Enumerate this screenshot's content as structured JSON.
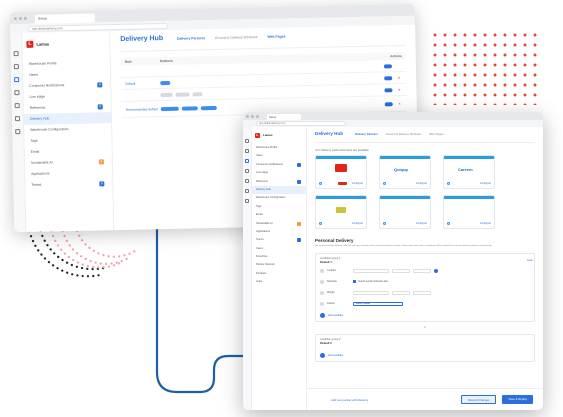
{
  "colors": {
    "accent": "#2a6fdb",
    "brand_red": "#e1251b",
    "dots_red": "#e8452c",
    "dots_pink": "#f0a4ab",
    "connector": "#1e5ea8"
  },
  "window_back": {
    "browser_tab": "Setup",
    "url": "app.dokandelivery.com",
    "logo": "Lamas",
    "nav": [
      {
        "label": "Warehouse Profile",
        "badge": ""
      },
      {
        "label": "Users",
        "badge": ""
      },
      {
        "label": "Consumer Notifications",
        "badge": "8"
      },
      {
        "label": "Line stage",
        "badge": ""
      },
      {
        "label": "Reference",
        "badge": "8"
      },
      {
        "label": "Delivery Hub",
        "badge": ""
      },
      {
        "label": "Warehouse Configuration",
        "badge": ""
      },
      {
        "label": "Tags",
        "badge": ""
      },
      {
        "label": "Email",
        "badge": ""
      },
      {
        "label": "Sustainable AI",
        "badge": "8"
      },
      {
        "label": "Applications",
        "badge": ""
      },
      {
        "label": "Teams",
        "badge": "8"
      }
    ],
    "title": "Delivery Hub",
    "tabs": [
      "Delivery Partners",
      "Ground & Delivery Windows",
      "Web Pages"
    ],
    "table_headers": [
      "Rule",
      "Partners",
      "Actions"
    ],
    "rows": [
      {
        "name": "",
        "partner": ""
      },
      {
        "name": "Default",
        "partner": ""
      },
      {
        "name": "",
        "partner": ""
      },
      {
        "name": "Recommended default",
        "partner": ""
      }
    ]
  },
  "window_front": {
    "browser_tab": "Setup",
    "url": "app.dokandelivery.com",
    "logo": "Lamas",
    "nav": [
      {
        "label": "Warehouse Profile",
        "badge": ""
      },
      {
        "label": "Users",
        "badge": ""
      },
      {
        "label": "Consumer Notifications",
        "badge": "8"
      },
      {
        "label": "Line stage",
        "badge": ""
      },
      {
        "label": "Reference",
        "badge": "8"
      },
      {
        "label": "Delivery Hub",
        "badge": ""
      },
      {
        "label": "Warehouse Configuration",
        "badge": ""
      },
      {
        "label": "Tags",
        "badge": ""
      },
      {
        "label": "Email",
        "badge": ""
      },
      {
        "label": "Sustainable AI",
        "badge": "8"
      },
      {
        "label": "Applications",
        "badge": ""
      },
      {
        "label": "Teams",
        "badge": "8"
      },
      {
        "label": "Users",
        "badge": ""
      },
      {
        "label": "Franchise",
        "badge": ""
      },
      {
        "label": "Partner Network",
        "badge": ""
      },
      {
        "label": "Products",
        "badge": ""
      },
      {
        "label": "Links",
        "badge": ""
      }
    ],
    "title": "Delivery Hub",
    "tabs": [
      "Delivery Partners",
      "Ground & Delivery Windows",
      "Web Pages"
    ],
    "subtitle": "Your delivery partners/carriers are available",
    "partners": [
      {
        "logo": "",
        "action": "Configure"
      },
      {
        "logo": "Quiqup",
        "action": "Configure"
      },
      {
        "logo": "Careem",
        "action": "Configure"
      },
      {
        "logo": "",
        "action": "Configure"
      },
      {
        "logo": "",
        "action": "Configure"
      },
      {
        "logo": "",
        "action": "Configure"
      }
    ],
    "section_title": "Personal Delivery",
    "section_desc": "Set up personalized delivery rules for your store based on the selected conditions below. Orders that match these conditions will be routed to the chosen delivery partner automatically.",
    "section_link": "Learn",
    "panel1": {
      "label": "Condition group 1",
      "name": "Default 1",
      "rows": [
        {
          "label": "Location",
          "text": ""
        },
        {
          "label": "Schedule",
          "text": "Search results Schedule date"
        },
        {
          "label": "Weight",
          "text": ""
        },
        {
          "label": "Partner",
          "text": "Select Partner"
        }
      ]
    },
    "add_condition": "Add condition",
    "or_label": "or",
    "panel2": {
      "label": "Condition group 2",
      "name": "Default 2"
    },
    "add_condition_2": "Add condition",
    "footer_link": "Add new partner with Delivery",
    "discard_label": "Discard Changes",
    "save_label": "Save & Deploy"
  }
}
